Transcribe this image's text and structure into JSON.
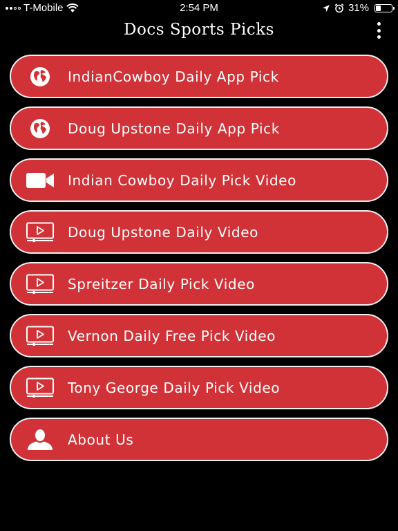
{
  "status_bar": {
    "carrier": "T-Mobile",
    "time": "2:54 PM",
    "battery_percent": "31%",
    "battery_level": 0.31,
    "icons": [
      "signal-icon",
      "wifi-icon",
      "location-icon",
      "alarm-icon",
      "battery-icon"
    ]
  },
  "header": {
    "title": "Docs Sports Picks",
    "menu_icon": "more-vertical-icon"
  },
  "menu": {
    "items": [
      {
        "label": "IndianCowboy Daily App Pick",
        "icon": "globe-icon"
      },
      {
        "label": "Doug Upstone Daily App Pick",
        "icon": "globe-icon"
      },
      {
        "label": "Indian Cowboy Daily Pick Video",
        "icon": "video-camera-icon"
      },
      {
        "label": "Doug Upstone Daily Video",
        "icon": "video-player-icon"
      },
      {
        "label": "Spreitzer Daily Pick Video",
        "icon": "video-player-icon"
      },
      {
        "label": "Vernon Daily Free Pick Video",
        "icon": "video-player-icon"
      },
      {
        "label": "Tony George Daily Pick Video",
        "icon": "video-player-icon"
      },
      {
        "label": "About Us",
        "icon": "user-icon"
      }
    ]
  },
  "colors": {
    "background": "#000000",
    "button": "#d13237",
    "button_border": "#f2f2f2",
    "text": "#ffffff"
  }
}
